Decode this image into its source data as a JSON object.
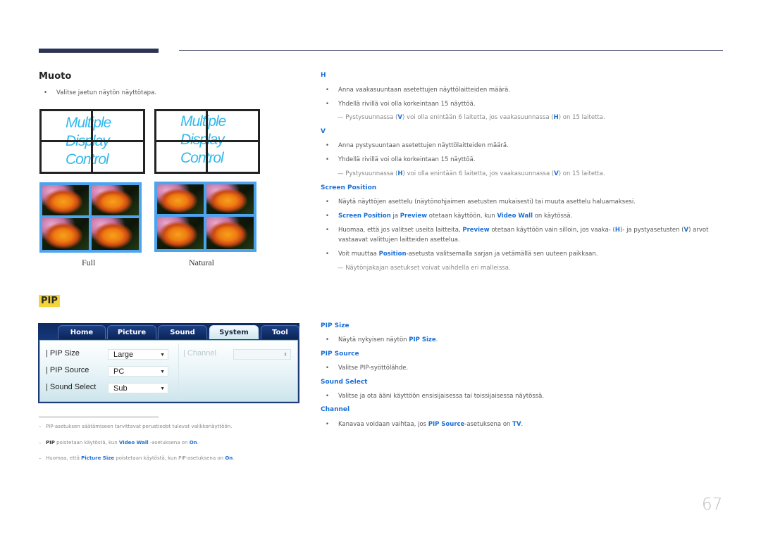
{
  "left": {
    "heading": "Muoto",
    "bullet": "Valitse jaetun näytön näyttötapa.",
    "mdc_lines": [
      "Multiple",
      "Display",
      "Control"
    ],
    "captions": {
      "full": "Full",
      "natural": "Natural"
    }
  },
  "pip": {
    "badge": "PIP",
    "ui": {
      "tabs": [
        "Home",
        "Picture",
        "Sound",
        "System",
        "Tool"
      ],
      "active_tab": "System",
      "rows": [
        {
          "label": "PIP Size",
          "value": "Large"
        },
        {
          "label": "PIP Source",
          "value": "PC"
        },
        {
          "label": "Sound Select",
          "value": "Sub"
        }
      ],
      "channel_label": "Channel",
      "channel_value": ""
    },
    "footnotes": {
      "f1": "PIP-asetuksen säätämiseen tarvittavat perustiedot tulevat valikkonäyttöön.",
      "f2_a": "PIP",
      "f2_b": " poistetaan käytöstä, kun ",
      "f2_c": "Video Wall",
      "f2_d": " -asetuksena on ",
      "f2_e": "On",
      "f2_f": ".",
      "f3_a": "Huomaa, että ",
      "f3_b": "Picture Size",
      "f3_c": " poistetaan käytöstä, kun PIP-asetuksena on ",
      "f3_d": "On",
      "f3_e": "."
    }
  },
  "right": {
    "h": {
      "title": "H",
      "b1": "Anna vaakasuuntaan asetettujen näyttölaitteiden määrä.",
      "b2": "Yhdellä rivillä voi olla korkeintaan 15 näyttöä.",
      "n_a": " Pystysuunnassa (",
      "n_b": "V",
      "n_c": ") voi olla enintään 6 laitetta, jos vaakasuunnassa (",
      "n_d": "H",
      "n_e": ") on 15 laitetta."
    },
    "v": {
      "title": "V",
      "b1": "Anna pystysuuntaan asetettujen näyttölaitteiden määrä.",
      "b2": "Yhdellä rivillä voi olla korkeintaan 15 näyttöä.",
      "n_a": " Pystysuunnassa (",
      "n_b": "H",
      "n_c": ") voi olla enintään 6 laitetta, jos vaakasuunnassa (",
      "n_d": "V",
      "n_e": ") on 15 laitetta."
    },
    "screen_position": {
      "title": "Screen Position",
      "b1": "Näytä näyttöjen asettelu (näytönohjaimen asetusten mukaisesti) tai muuta asettelu haluamaksesi.",
      "b2_a": "Screen Position",
      "b2_b": " ja ",
      "b2_c": "Preview",
      "b2_d": " otetaan käyttöön, kun ",
      "b2_e": "Video Wall",
      "b2_f": " on käytössä.",
      "b3_a": "Huomaa, että jos valitset useita laitteita, ",
      "b3_b": "Preview",
      "b3_c": " otetaan käyttöön vain silloin, jos vaaka- (",
      "b3_d": "H",
      "b3_e": ")- ja pystyasetusten (",
      "b3_f": "V",
      "b3_g": ") arvot",
      "b3_line2": "vastaavat valittujen laitteiden asettelua.",
      "b4_a": "Voit muuttaa ",
      "b4_b": "Position",
      "b4_c": "-asetusta valitsemalla sarjan ja vetämällä sen uuteen paikkaan.",
      "note": " Näytönjakajan asetukset voivat vaihdella eri malleissa."
    },
    "pip_size": {
      "title": "PIP Size",
      "b_a": "Näytä nykyisen näytön ",
      "b_b": "PIP Size",
      "b_c": "."
    },
    "pip_source": {
      "title": "PIP Source",
      "b": "Valitse PIP-syöttölähde."
    },
    "sound_select": {
      "title": "Sound Select",
      "b": "Valitse ja ota ääni käyttöön ensisijaisessa tai toissijaisessa näytössä."
    },
    "channel": {
      "title": "Channel",
      "b_a": "Kanavaa voidaan vaihtaa, jos ",
      "b_b": "PIP Source",
      "b_c": "-asetuksena on ",
      "b_d": "TV",
      "b_e": "."
    }
  },
  "symbols": {
    "bullet": "•",
    "note_dash": "—",
    "footnote_dash": "–",
    "dropdown_arrow": "▼",
    "spinner": "⬍"
  },
  "page_number": "67"
}
